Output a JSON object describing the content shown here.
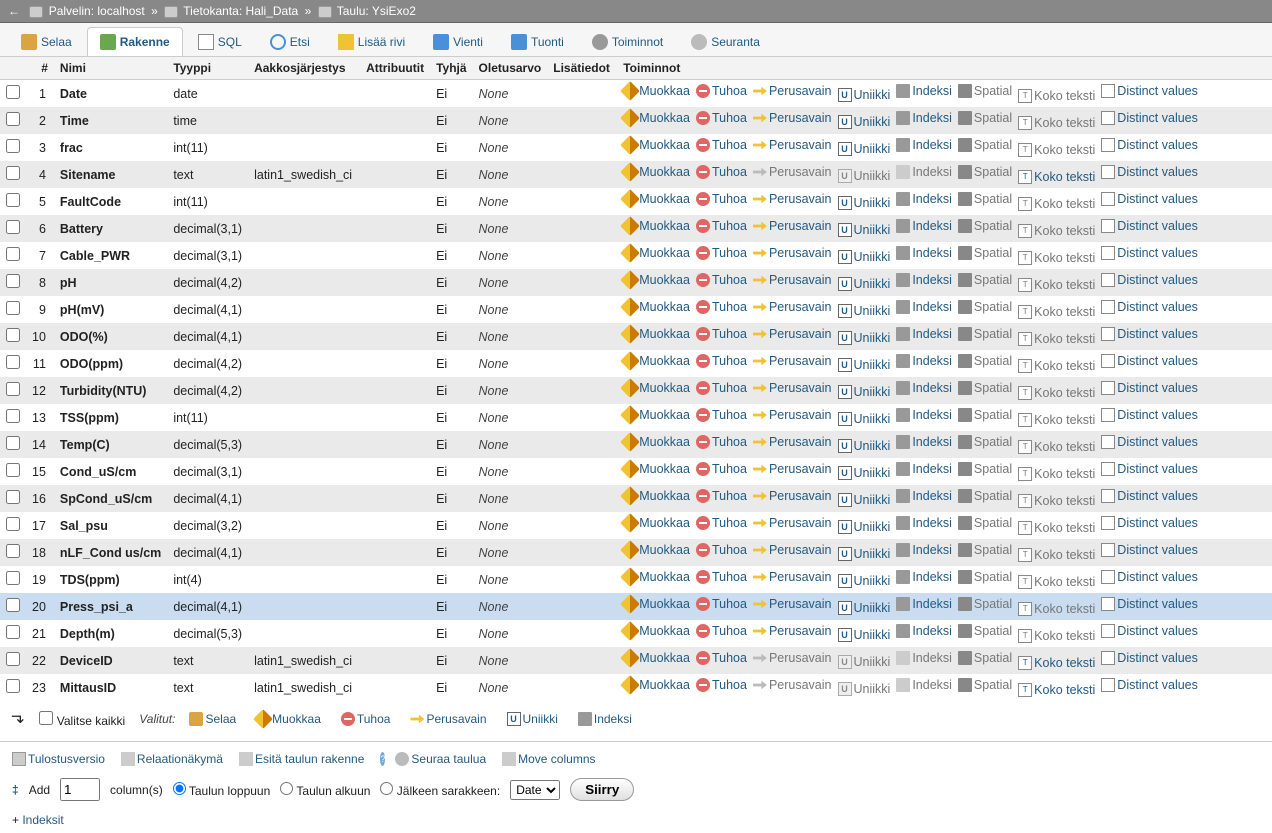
{
  "breadcrumb": {
    "server_label": "Palvelin:",
    "server": "localhost",
    "db_label": "Tietokanta:",
    "db": "Hali_Data",
    "table_label": "Taulu:",
    "table": "YsiExo2"
  },
  "tabs": {
    "browse": "Selaa",
    "structure": "Rakenne",
    "sql": "SQL",
    "search": "Etsi",
    "insert": "Lisää rivi",
    "export": "Vienti",
    "import": "Tuonti",
    "operations": "Toiminnot",
    "tracking": "Seuranta"
  },
  "headers": {
    "num": "#",
    "name": "Nimi",
    "type": "Tyyppi",
    "collation": "Aakkosjärjestys",
    "attributes": "Attribuutit",
    "null": "Tyhjä",
    "default": "Oletusarvo",
    "extra": "Lisätiedot",
    "action": "Toiminnot"
  },
  "action_labels": {
    "edit": "Muokkaa",
    "drop": "Tuhoa",
    "primary": "Perusavain",
    "unique": "Uniikki",
    "index": "Indeksi",
    "spatial": "Spatial",
    "fulltext": "Koko teksti",
    "distinct": "Distinct values"
  },
  "null_no": "Ei",
  "default_none": "None",
  "columns": [
    {
      "n": 1,
      "name": "Date",
      "type": "date",
      "coll": "",
      "key": true,
      "idx": true,
      "spat": false,
      "full": false
    },
    {
      "n": 2,
      "name": "Time",
      "type": "time",
      "coll": "",
      "key": true,
      "idx": true,
      "spat": false,
      "full": false
    },
    {
      "n": 3,
      "name": "frac",
      "type": "int(11)",
      "coll": "",
      "key": true,
      "idx": true,
      "spat": false,
      "full": false
    },
    {
      "n": 4,
      "name": "Sitename",
      "type": "text",
      "coll": "latin1_swedish_ci",
      "key": false,
      "idx": false,
      "spat": false,
      "full": true
    },
    {
      "n": 5,
      "name": "FaultCode",
      "type": "int(11)",
      "coll": "",
      "key": true,
      "idx": true,
      "spat": false,
      "full": false
    },
    {
      "n": 6,
      "name": "Battery",
      "type": "decimal(3,1)",
      "coll": "",
      "key": true,
      "idx": true,
      "spat": false,
      "full": false
    },
    {
      "n": 7,
      "name": "Cable_PWR",
      "type": "decimal(3,1)",
      "coll": "",
      "key": true,
      "idx": true,
      "spat": false,
      "full": false
    },
    {
      "n": 8,
      "name": "pH",
      "type": "decimal(4,2)",
      "coll": "",
      "key": true,
      "idx": true,
      "spat": false,
      "full": false
    },
    {
      "n": 9,
      "name": "pH(mV)",
      "type": "decimal(4,1)",
      "coll": "",
      "key": true,
      "idx": true,
      "spat": false,
      "full": false
    },
    {
      "n": 10,
      "name": "ODO(%)",
      "type": "decimal(4,1)",
      "coll": "",
      "key": true,
      "idx": true,
      "spat": false,
      "full": false
    },
    {
      "n": 11,
      "name": "ODO(ppm)",
      "type": "decimal(4,2)",
      "coll": "",
      "key": true,
      "idx": true,
      "spat": false,
      "full": false
    },
    {
      "n": 12,
      "name": "Turbidity(NTU)",
      "type": "decimal(4,2)",
      "coll": "",
      "key": true,
      "idx": true,
      "spat": false,
      "full": false
    },
    {
      "n": 13,
      "name": "TSS(ppm)",
      "type": "int(11)",
      "coll": "",
      "key": true,
      "idx": true,
      "spat": false,
      "full": false
    },
    {
      "n": 14,
      "name": "Temp(C)",
      "type": "decimal(5,3)",
      "coll": "",
      "key": true,
      "idx": true,
      "spat": false,
      "full": false
    },
    {
      "n": 15,
      "name": "Cond_uS/cm",
      "type": "decimal(3,1)",
      "coll": "",
      "key": true,
      "idx": true,
      "spat": false,
      "full": false
    },
    {
      "n": 16,
      "name": "SpCond_uS/cm",
      "type": "decimal(4,1)",
      "coll": "",
      "key": true,
      "idx": true,
      "spat": false,
      "full": false
    },
    {
      "n": 17,
      "name": "Sal_psu",
      "type": "decimal(3,2)",
      "coll": "",
      "key": true,
      "idx": true,
      "spat": false,
      "full": false
    },
    {
      "n": 18,
      "name": "nLF_Cond us/cm",
      "type": "decimal(4,1)",
      "coll": "",
      "key": true,
      "idx": true,
      "spat": false,
      "full": false
    },
    {
      "n": 19,
      "name": "TDS(ppm)",
      "type": "int(4)",
      "coll": "",
      "key": true,
      "idx": true,
      "spat": false,
      "full": false
    },
    {
      "n": 20,
      "name": "Press_psi_a",
      "type": "decimal(4,1)",
      "coll": "",
      "key": true,
      "idx": true,
      "spat": false,
      "full": false,
      "selected": true
    },
    {
      "n": 21,
      "name": "Depth(m)",
      "type": "decimal(5,3)",
      "coll": "",
      "key": true,
      "idx": true,
      "spat": false,
      "full": false
    },
    {
      "n": 22,
      "name": "DeviceID",
      "type": "text",
      "coll": "latin1_swedish_ci",
      "key": false,
      "idx": false,
      "spat": false,
      "full": true
    },
    {
      "n": 23,
      "name": "MittausID",
      "type": "text",
      "coll": "latin1_swedish_ci",
      "key": false,
      "idx": false,
      "spat": false,
      "full": true
    }
  ],
  "footer": {
    "check_all": "Valitse kaikki",
    "with_selected": "Valitut:",
    "browse": "Selaa",
    "edit": "Muokkaa",
    "drop": "Tuhoa",
    "primary": "Perusavain",
    "unique": "Uniikki",
    "index": "Indeksi"
  },
  "below_links": {
    "print": "Tulostusversio",
    "relation": "Relaationäkymä",
    "propose": "Esitä taulun rakenne",
    "track": "Seuraa taulua",
    "move": "Move columns"
  },
  "add_row": {
    "add_icon_label": "Add",
    "count": "1",
    "columns_word": "column(s)",
    "at_end": "Taulun loppuun",
    "at_begin": "Taulun alkuun",
    "after": "Jälkeen sarakkeen:",
    "after_col": "Date",
    "go": "Siirry"
  },
  "indexes_link": "Indeksit"
}
